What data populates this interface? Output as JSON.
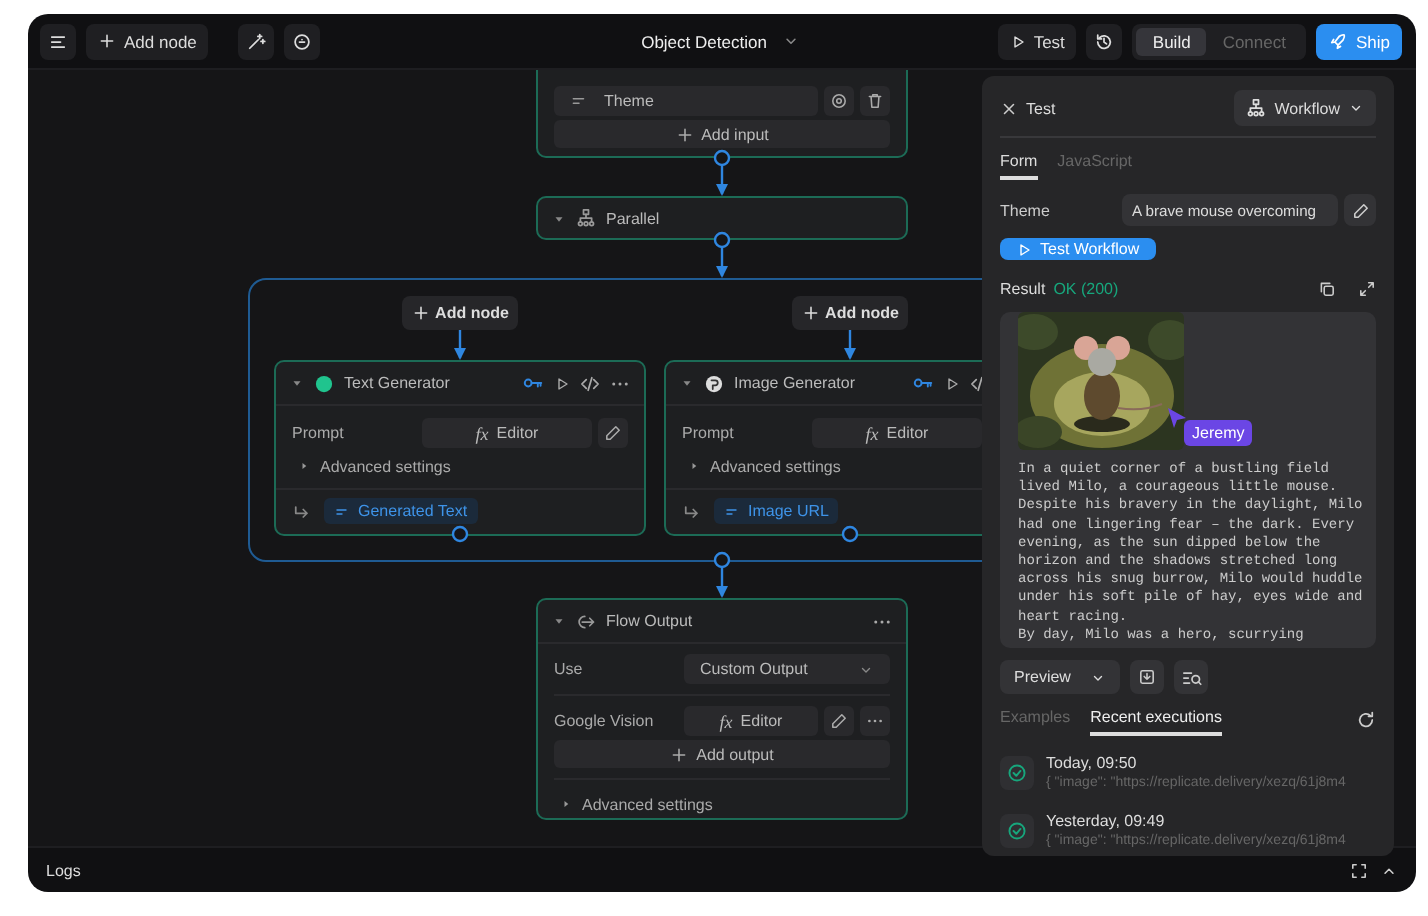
{
  "toolbar": {
    "add_node": "Add node",
    "title": "Object Detection",
    "test": "Test",
    "modes": [
      {
        "label": "Build",
        "selected": true
      },
      {
        "label": "Connect",
        "selected": false
      }
    ],
    "ship": "Ship"
  },
  "canvas": {
    "input_node": {
      "inputs": [
        {
          "label": "Theme"
        }
      ],
      "add_label": "Add input"
    },
    "parallel_node": {
      "title": "Parallel"
    },
    "branches": [
      {
        "add_node": "Add node",
        "node": {
          "kind": "text",
          "title": "Text Generator",
          "prompt_label": "Prompt",
          "prompt_icon": "fx",
          "prompt_value": "Editor",
          "advanced": "Advanced settings",
          "output": "Generated Text"
        }
      },
      {
        "add_node": "Add node",
        "node": {
          "title": "Image Generator",
          "prompt_label": "Prompt",
          "prompt_icon": "fx",
          "prompt_value": "Editor",
          "advanced": "Advanced settings",
          "output": "Image URL"
        }
      }
    ],
    "output_node": {
      "title": "Flow Output",
      "use_label": "Use",
      "use_value": "Custom Output",
      "outputs": [
        {
          "label": "Google Vision",
          "icon": "fx",
          "value": "Editor"
        }
      ],
      "add_label": "Add output",
      "advanced": "Advanced settings"
    }
  },
  "test_panel": {
    "title": "Test",
    "mode": "Workflow",
    "tabs": [
      {
        "label": "Form",
        "selected": true
      },
      {
        "label": "JavaScript",
        "selected": false
      }
    ],
    "fields": [
      {
        "label": "Theme",
        "value": "A brave mouse overcoming"
      }
    ],
    "run_button": "Test Workflow",
    "result_label": "Result",
    "result_status": "OK (200)",
    "cursor_tag": "Jeremy",
    "result_text": [
      "In a quiet corner of a bustling field lived Milo, a courageous little mouse. Despite his bravery in the daylight, Milo had one lingering fear – the dark. Every evening, as the sun dipped below the horizon and the shadows stretched long across his snug burrow, Milo would huddle under his soft pile of hay, eyes wide and heart racing.",
      "By day, Milo was a hero, scurrying"
    ],
    "view": "Preview",
    "history_tabs": [
      {
        "label": "Examples",
        "selected": false
      },
      {
        "label": "Recent executions",
        "selected": true
      }
    ],
    "executions": [
      {
        "time": "Today, 09:50",
        "output": "{ \"image\": \"https://replicate.delivery/xezq/61j8m4"
      },
      {
        "time": "Yesterday, 09:49",
        "output": "{ \"image\": \"https://replicate.delivery/xezq/61j8m4"
      }
    ]
  },
  "logs": {
    "title": "Logs"
  }
}
